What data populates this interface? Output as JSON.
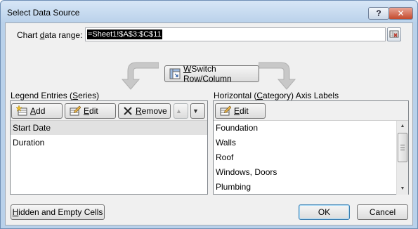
{
  "window": {
    "title": "Select Data Source",
    "help_label": "?",
    "close_label": "✕"
  },
  "range": {
    "label_pre": "Chart ",
    "label_accel": "d",
    "label_post": "ata range:",
    "value": "=Sheet1!$A$3:$C$11"
  },
  "switch": {
    "accel": "W",
    "rest": "Switch Row/Column"
  },
  "legend": {
    "label_pre": "Legend Entries (",
    "label_accel": "S",
    "label_post": "eries)",
    "add_accel": "A",
    "add_rest": "dd",
    "edit_accel": "E",
    "edit_rest": "dit",
    "remove_accel": "R",
    "remove_rest": "emove",
    "items": [
      "Start Date",
      "Duration"
    ],
    "selected_index": 0
  },
  "axis": {
    "label_pre": "Horizontal (",
    "label_accel": "C",
    "label_post": "ategory) Axis Labels",
    "edit_accel": "E",
    "edit_rest": "dit",
    "items": [
      "Foundation",
      "Walls",
      "Roof",
      "Windows, Doors",
      "Plumbing"
    ]
  },
  "footer": {
    "hidden_accel": "H",
    "hidden_rest": "idden and Empty Cells",
    "ok_label": "OK",
    "cancel_label": "Cancel"
  },
  "colors": {
    "frame": "#b9d1ea",
    "client": "#f0f0f0",
    "selection": "#e1e1e1",
    "close_button": "#c44a2d"
  }
}
